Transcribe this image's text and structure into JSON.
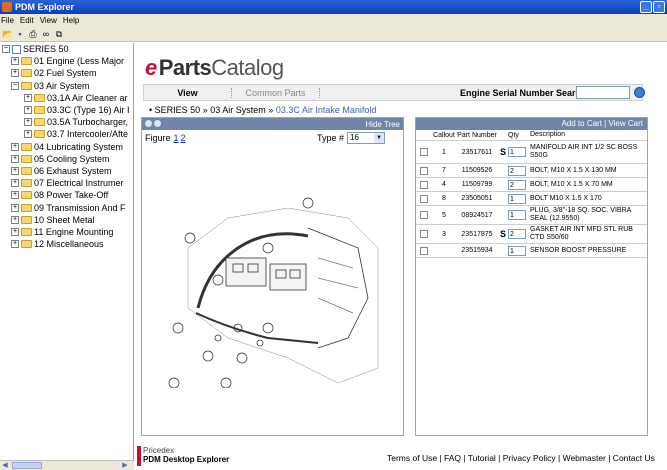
{
  "window": {
    "title": "PDM Explorer"
  },
  "menu": [
    "File",
    "Edit",
    "View",
    "Help"
  ],
  "toolbar_icons": [
    "save-icon",
    "print-icon",
    "binoculars-icon",
    "copy-icon"
  ],
  "tree": {
    "root": "SERIES 50",
    "items": [
      {
        "label": "01  Engine (Less Major",
        "level": 1,
        "exp": "+",
        "kind": "folder"
      },
      {
        "label": "02  Fuel System",
        "level": 1,
        "exp": "+",
        "kind": "folder"
      },
      {
        "label": "03  Air System",
        "level": 1,
        "exp": "-",
        "kind": "folder"
      },
      {
        "label": "03.1A Air Cleaner ar",
        "level": 2,
        "exp": "+",
        "kind": "folder"
      },
      {
        "label": "03.3C (Type 16) Air I",
        "level": 2,
        "exp": "+",
        "kind": "folder"
      },
      {
        "label": "03.5A Turbocharger,",
        "level": 2,
        "exp": "+",
        "kind": "folder"
      },
      {
        "label": "03.7 Intercooler/Afte",
        "level": 2,
        "exp": "+",
        "kind": "folder"
      },
      {
        "label": "04  Lubricating System",
        "level": 1,
        "exp": "+",
        "kind": "folder"
      },
      {
        "label": "05  Cooling System",
        "level": 1,
        "exp": "+",
        "kind": "folder"
      },
      {
        "label": "06  Exhaust System",
        "level": 1,
        "exp": "+",
        "kind": "folder"
      },
      {
        "label": "07  Electrical Instrumer",
        "level": 1,
        "exp": "+",
        "kind": "folder"
      },
      {
        "label": "08  Power Take-Off",
        "level": 1,
        "exp": "+",
        "kind": "folder"
      },
      {
        "label": "09  Transmission And F",
        "level": 1,
        "exp": "+",
        "kind": "folder"
      },
      {
        "label": "10  Sheet Metal",
        "level": 1,
        "exp": "+",
        "kind": "folder"
      },
      {
        "label": "11  Engine Mounting",
        "level": 1,
        "exp": "+",
        "kind": "folder"
      },
      {
        "label": "12  Miscellaneous",
        "level": 1,
        "exp": "+",
        "kind": "folder"
      }
    ]
  },
  "logo": {
    "parts": "Parts",
    "catalog": "Catalog"
  },
  "nav": {
    "view": "View",
    "common_parts": "Common Parts",
    "serial_label": "Engine Serial Number Search",
    "serial_value": ""
  },
  "breadcrumb": {
    "series": "SERIES 50",
    "sep1": "»",
    "system": "03 Air System",
    "sep2": "»",
    "current": "03.3C Air Intake Manifold"
  },
  "figure": {
    "hide_tree": "Hide Tree",
    "label": "Figure",
    "pages": [
      "1",
      "2"
    ],
    "type_label": "Type #",
    "type_value": "16"
  },
  "parts": {
    "header_links": "Add to Cart | View Cart",
    "columns": [
      "Callout",
      "Part Number",
      "Qty",
      "Description"
    ],
    "rows": [
      {
        "callout": "1",
        "part": "23517611",
        "s": "S",
        "qty": "1",
        "desc": "MANIFOLD AIR INT 1/2 SC BOSS S50G"
      },
      {
        "callout": "7",
        "part": "11509526",
        "s": "",
        "qty": "2",
        "desc": "BOLT, M10 X 1.5 X 130 MM"
      },
      {
        "callout": "4",
        "part": "11509799",
        "s": "",
        "qty": "2",
        "desc": "BOLT, M10 X 1.5 X 70 MM"
      },
      {
        "callout": "8",
        "part": "23505051",
        "s": "",
        "qty": "1",
        "desc": "BOLT M10 X 1.5 X 170"
      },
      {
        "callout": "5",
        "part": "08924517",
        "s": "",
        "qty": "1",
        "desc": "PLUG, 3/8\"-18 SQ. SOC. VIBRA SEAL (12.9550)"
      },
      {
        "callout": "3",
        "part": "23517875",
        "s": "S",
        "qty": "2",
        "desc": "GASKET AIR INT MFD STL RUB CTD S50/60"
      },
      {
        "callout": "",
        "part": "23515934",
        "s": "",
        "qty": "1",
        "desc": "SENSOR BOOST PRESSURE"
      }
    ]
  },
  "footer": {
    "brand1": "Pricedex",
    "brand2": "PDM Desktop Explorer",
    "links": "Terms of Use | FAQ | Tutorial | Privacy Policy | Webmaster | Contact Us"
  },
  "colors": {
    "titlebar": "#0a3fb8",
    "panel_header": "#6f86a8",
    "logo_red": "#c8102e",
    "link_blue": "#0033cc"
  }
}
